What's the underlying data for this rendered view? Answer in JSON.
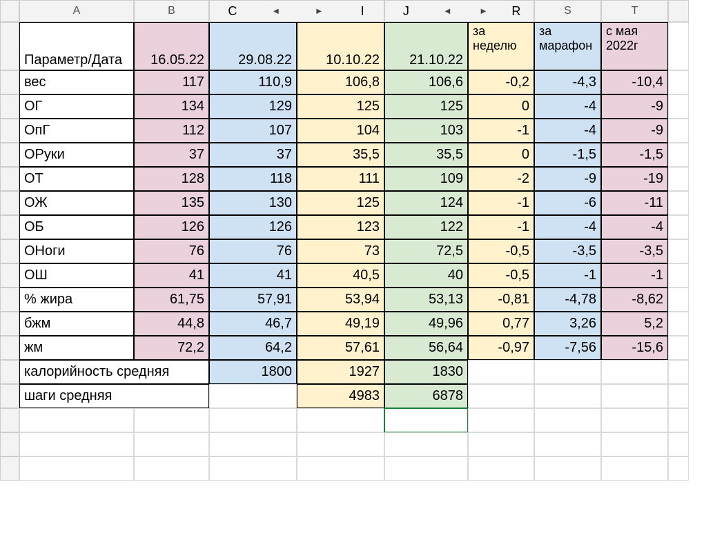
{
  "columns": {
    "A": "A",
    "B": "B",
    "C": "C",
    "I": "I",
    "J": "J",
    "R": "R",
    "S": "S",
    "T": "T"
  },
  "arrows": {
    "left": "◀",
    "right": "▶"
  },
  "header_row": {
    "A": "Параметр/Дата",
    "B": "16.05.22",
    "C": "29.08.22",
    "I": "10.10.22",
    "J": "21.10.22",
    "R": "за неделю",
    "S": "за марафон",
    "T": "с мая 2022г"
  },
  "rows": [
    {
      "A": "вес",
      "B": "117",
      "C": "110,9",
      "I": "106,8",
      "J": "106,6",
      "R": "-0,2",
      "S": "-4,3",
      "T": "-10,4"
    },
    {
      "A": "ОГ",
      "B": "134",
      "C": "129",
      "I": "125",
      "J": "125",
      "R": "0",
      "S": "-4",
      "T": "-9"
    },
    {
      "A": "ОпГ",
      "B": "112",
      "C": "107",
      "I": "104",
      "J": "103",
      "R": "-1",
      "S": "-4",
      "T": "-9"
    },
    {
      "A": "ОРуки",
      "B": "37",
      "C": "37",
      "I": "35,5",
      "J": "35,5",
      "R": "0",
      "S": "-1,5",
      "T": "-1,5"
    },
    {
      "A": "ОТ",
      "B": "128",
      "C": "118",
      "I": "111",
      "J": "109",
      "R": "-2",
      "S": "-9",
      "T": "-19"
    },
    {
      "A": "ОЖ",
      "B": "135",
      "C": "130",
      "I": "125",
      "J": "124",
      "R": "-1",
      "S": "-6",
      "T": "-11"
    },
    {
      "A": "ОБ",
      "B": "126",
      "C": "126",
      "I": "123",
      "J": "122",
      "R": "-1",
      "S": "-4",
      "T": "-4"
    },
    {
      "A": "ОНоги",
      "B": "76",
      "C": "76",
      "I": "73",
      "J": "72,5",
      "R": "-0,5",
      "S": "-3,5",
      "T": "-3,5"
    },
    {
      "A": "ОШ",
      "B": "41",
      "C": "41",
      "I": "40,5",
      "J": "40",
      "R": "-0,5",
      "S": "-1",
      "T": "-1"
    },
    {
      "A": "% жира",
      "B": "61,75",
      "C": "57,91",
      "I": "53,94",
      "J": "53,13",
      "R": "-0,81",
      "S": "-4,78",
      "T": "-8,62"
    },
    {
      "A": "бжм",
      "B": "44,8",
      "C": "46,7",
      "I": "49,19",
      "J": "49,96",
      "R": "0,77",
      "S": "3,26",
      "T": "5,2"
    },
    {
      "A": "жм",
      "B": "72,2",
      "C": "64,2",
      "I": "57,61",
      "J": "56,64",
      "R": "-0,97",
      "S": "-7,56",
      "T": "-15,6"
    }
  ],
  "footer": {
    "calories": {
      "label": "калорийность средняя",
      "C": "1800",
      "I": "1927",
      "J": "1830"
    },
    "steps": {
      "label": "шаги средняя",
      "I": "4983",
      "J": "6878"
    }
  },
  "chart_data": {
    "type": "table",
    "title": "Параметр/Дата",
    "columns": [
      "16.05.22",
      "29.08.22",
      "10.10.22",
      "21.10.22",
      "за неделю",
      "за марафон",
      "с мая 2022г"
    ],
    "rows": {
      "вес": [
        117,
        110.9,
        106.8,
        106.6,
        -0.2,
        -4.3,
        -10.4
      ],
      "ОГ": [
        134,
        129,
        125,
        125,
        0,
        -4,
        -9
      ],
      "ОпГ": [
        112,
        107,
        104,
        103,
        -1,
        -4,
        -9
      ],
      "ОРуки": [
        37,
        37,
        35.5,
        35.5,
        0,
        -1.5,
        -1.5
      ],
      "ОТ": [
        128,
        118,
        111,
        109,
        -2,
        -9,
        -19
      ],
      "ОЖ": [
        135,
        130,
        125,
        124,
        -1,
        -6,
        -11
      ],
      "ОБ": [
        126,
        126,
        123,
        122,
        -1,
        -4,
        -4
      ],
      "ОНоги": [
        76,
        76,
        73,
        72.5,
        -0.5,
        -3.5,
        -3.5
      ],
      "ОШ": [
        41,
        41,
        40.5,
        40,
        -0.5,
        -1,
        -1
      ],
      "% жира": [
        61.75,
        57.91,
        53.94,
        53.13,
        -0.81,
        -4.78,
        -8.62
      ],
      "бжм": [
        44.8,
        46.7,
        49.19,
        49.96,
        0.77,
        3.26,
        5.2
      ],
      "жм": [
        72.2,
        64.2,
        57.61,
        56.64,
        -0.97,
        -7.56,
        -15.6
      ],
      "калорийность средняя": [
        null,
        1800,
        1927,
        1830,
        null,
        null,
        null
      ],
      "шаги средняя": [
        null,
        null,
        4983,
        6878,
        null,
        null,
        null
      ]
    }
  }
}
